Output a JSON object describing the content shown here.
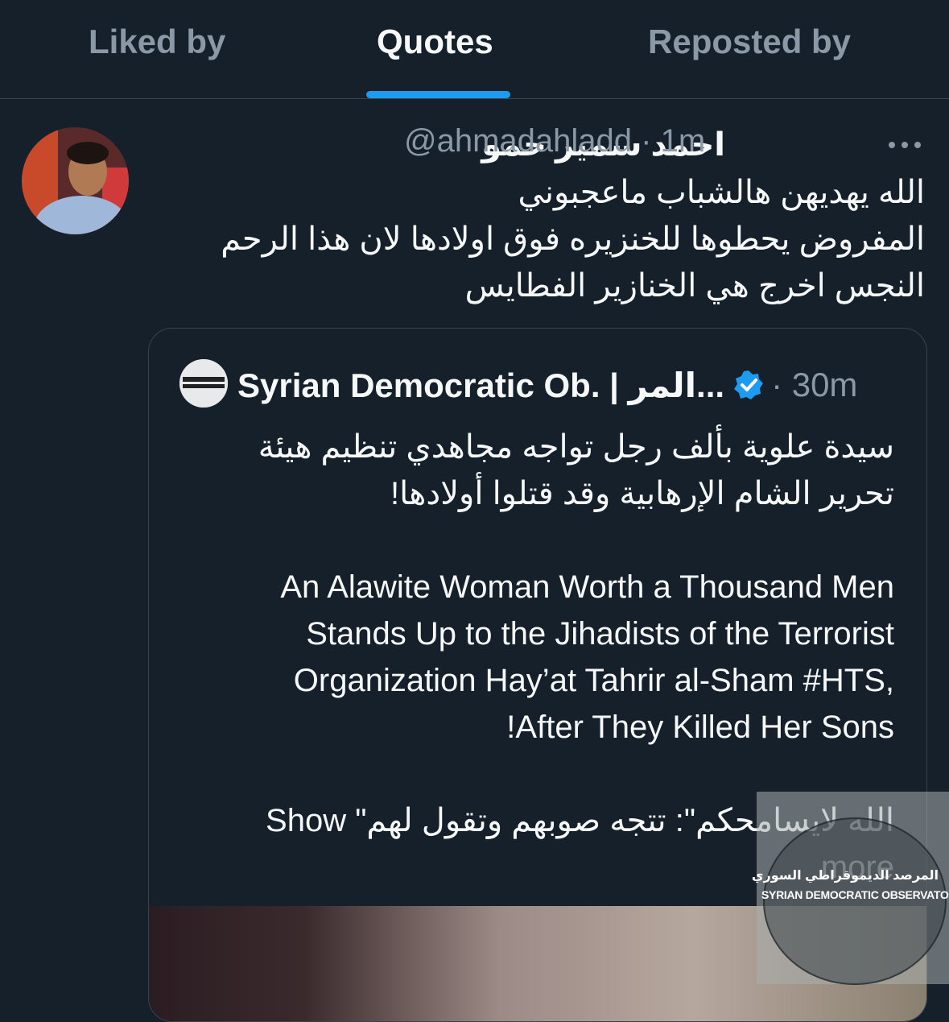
{
  "tabs": [
    {
      "label": "Liked by"
    },
    {
      "label": "Quotes"
    },
    {
      "label": "Reposted by"
    }
  ],
  "tweet": {
    "author_name": "احمد سمير حمو",
    "handle_time": "@ahmadahladd · 1m",
    "more_icon": "more-horizontal-icon",
    "lines": [
      "الله يهديهن هالشباب ماعجبوني",
      "المفروض يحطوها للخنزيره فوق اولادها لان هذا الرحم",
      "النجس اخرج هي الخنازير الفطايس"
    ]
  },
  "quote": {
    "author_name": "Syrian Democratic Ob. | المر...",
    "verified_icon": "verified-badge-icon",
    "time": "· 30m",
    "ar_lines": [
      "سيدة علوية بألف رجل تواجه مجاهدي تنظيم هيئة",
      "تحرير الشام الإرهابية وقد قتلوا أولادها!"
    ],
    "en_lines": [
      "An Alawite Woman Worth a Thousand Men",
      "Stands Up to the Jihadists of the Terrorist",
      "Organization Hay’at Tahrir al-Sham #HTS,",
      "!After They Killed Her Sons"
    ],
    "last_line": "Show \"الله لايسامحكم\": تتجه صوبهم وتقول لهم",
    "show_more": "more"
  },
  "watermark": {
    "ar": "المرصد الديموقراطي السوري",
    "en": "SYRIAN DEMOCRATIC OBSERVATORY"
  },
  "colors": {
    "background": "#15202b",
    "accent": "#1d9bf0",
    "secondary_text": "#8b98a5"
  }
}
